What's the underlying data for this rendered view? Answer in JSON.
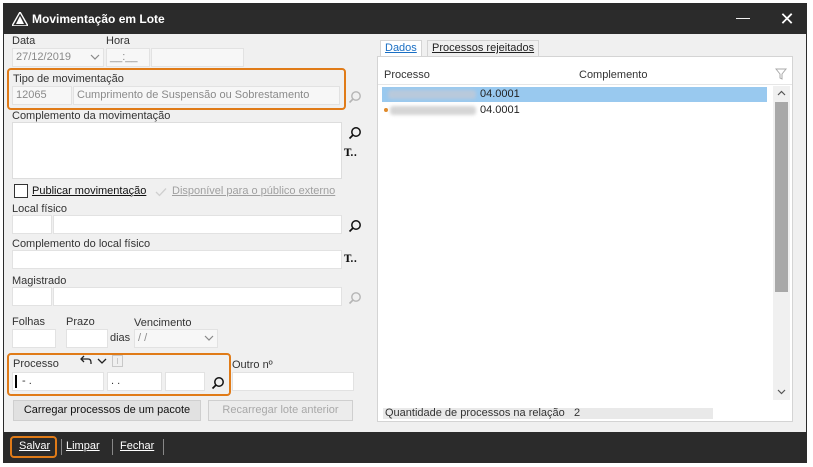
{
  "window": {
    "title": "Movimentação em Lote"
  },
  "form": {
    "data_label": "Data",
    "data_value": "27/12/2019",
    "hora_label": "Hora",
    "hora_value": "__:__",
    "tipo_label": "Tipo de movimentação",
    "tipo_code": "12065",
    "tipo_desc": "Cumprimento de Suspensão ou Sobrestamento",
    "complemento_label": "Complemento da movimentação",
    "publicar_label": "Publicar movimentação",
    "disponivel_label": "Disponível para o público externo",
    "local_label": "Local físico",
    "complemento_local_label": "Complemento do local físico",
    "magistrado_label": "Magistrado",
    "folhas_label": "Folhas",
    "prazo_label": "Prazo",
    "dias_label": "dias",
    "vencimento_label": "Vencimento",
    "vencimento_value": " /  /",
    "processo_label": "Processo",
    "processo_part1": "    - .",
    "processo_part2": " . .",
    "outro_label": "Outro nº",
    "carregar_label": "Carregar processos de um pacote",
    "recarregar_label": "Recarregar lote anterior"
  },
  "tabs": [
    {
      "label": "Dados",
      "active": true
    },
    {
      "label": "Processos rejeitados",
      "active": false
    }
  ],
  "grid": {
    "col_processo": "Processo",
    "col_complemento": "Complemento",
    "rows": [
      {
        "suffix": "04.0001",
        "selected": true
      },
      {
        "suffix": "04.0001",
        "selected": false
      }
    ]
  },
  "footer": {
    "quantidade_label": "Quantidade de processos na relação",
    "quantidade_value": "2"
  },
  "bottom": {
    "salvar": "Salvar",
    "limpar": "Limpar",
    "fechar": "Fechar"
  },
  "colors": {
    "titlebar": "#2b2b2b",
    "highlight": "#e07b18",
    "selection": "#99c9ef",
    "tab_active": "#1a6fc4"
  }
}
